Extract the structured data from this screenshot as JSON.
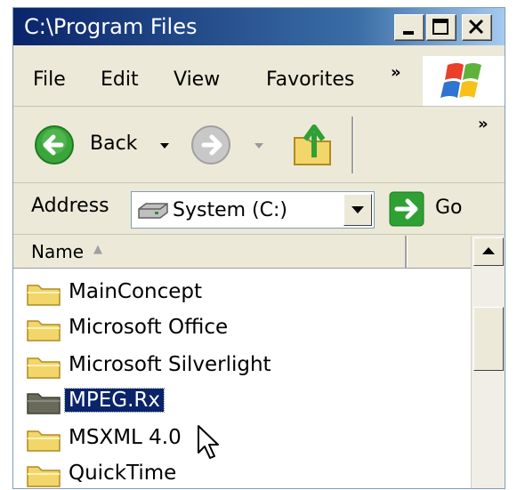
{
  "window": {
    "title": "C:\\Program Files"
  },
  "title_buttons": {
    "minimize": "minimize",
    "maximize": "maximize",
    "close": "close"
  },
  "menu": {
    "items": [
      "File",
      "Edit",
      "View",
      "Favorites"
    ],
    "overflow": "»"
  },
  "toolbar": {
    "back_label": "Back",
    "overflow": "»"
  },
  "address": {
    "label": "Address",
    "value": "System (C:)",
    "go_label": "Go"
  },
  "list": {
    "column_header": "Name",
    "sort_indicator": "▲",
    "items": [
      {
        "name": "MainConcept",
        "selected": false
      },
      {
        "name": "Microsoft Office",
        "selected": false
      },
      {
        "name": "Microsoft Silverlight",
        "selected": false
      },
      {
        "name": "MPEG.Rx",
        "selected": true
      },
      {
        "name": "MSXML 4.0",
        "selected": false
      },
      {
        "name": "QuickTime",
        "selected": false
      }
    ]
  },
  "icons": {
    "back": "back-arrow-icon",
    "forward": "forward-arrow-icon",
    "up": "up-folder-icon",
    "drive": "drive-icon",
    "go": "go-arrow-icon",
    "folder": "folder-icon",
    "logo": "windows-logo-icon",
    "cursor": "mouse-cursor-icon"
  },
  "colors": {
    "title_bar_start": "#0a246a",
    "title_bar_end": "#a6caf0",
    "selection": "#0a246a",
    "chrome": "#ece9d8",
    "go_green": "#2fa033",
    "back_green": "#3aa53a",
    "folder_yellow": "#f3d66a"
  }
}
